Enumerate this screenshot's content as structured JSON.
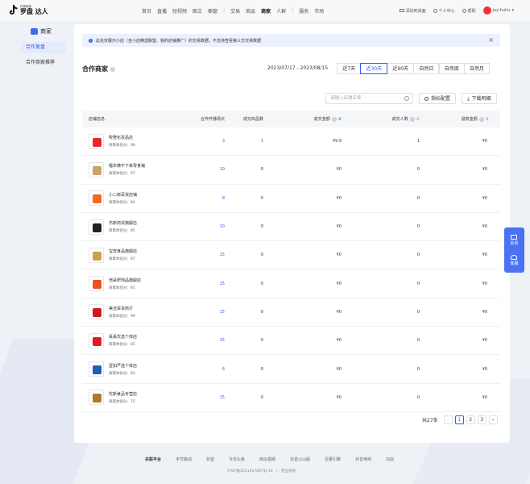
{
  "brand": {
    "small": "抖音电商",
    "big": "罗盘 达人"
  },
  "nav": {
    "items": [
      "首页",
      "直播",
      "短视频",
      "图文",
      "橱窗",
      "交易",
      "商品",
      "商家",
      "人群",
      "服务",
      "市场"
    ],
    "active": "商家"
  },
  "top_right": {
    "add_desktop": "添加到桌面",
    "personal_center": "个人中心",
    "help": "帮助",
    "username": "joy-huhu"
  },
  "sidebar": {
    "title": "商家",
    "items": [
      {
        "label": "合作复盘",
        "active": true
      },
      {
        "label": "合作商家推荐",
        "active": false
      }
    ]
  },
  "notice": {
    "text": "此处仅展示小店（含小店精选联盟、我的店铺推广）的交易数据，不支持查看第三方交易数据"
  },
  "section": {
    "title": "合作商家",
    "date_range": "2023/07/17 - 2023/08/15",
    "ranges": [
      {
        "label": "近7天",
        "active": false
      },
      {
        "label": "近30天",
        "active": true
      },
      {
        "label": "近90天",
        "active": false
      },
      {
        "label": "自然日",
        "active": false
      },
      {
        "label": "自然周",
        "active": false
      },
      {
        "label": "自然月",
        "active": false
      }
    ]
  },
  "toolbar": {
    "search_placeholder": "请输入店铺名称",
    "metrics_label": "指标配置",
    "download_label": "下载明细"
  },
  "table": {
    "headers": {
      "shop": "店铺信息",
      "sessions": "合作开播场次",
      "products": "成交商品数",
      "gmv": "成交金额",
      "buyers": "成交人数",
      "refund": "退款金额"
    },
    "score_prefix": "商家体验分：",
    "rows": [
      {
        "name": "牧橙化妆品店",
        "score": "98",
        "sessions": "3",
        "products": "1",
        "gmv": "¥9.9",
        "buyers": "1",
        "refund": "¥0",
        "logo_color": "#e8262d"
      },
      {
        "name": "榴本佛不下来零食铺",
        "score": "97",
        "sessions": "10",
        "products": "0",
        "gmv": "¥0",
        "buyers": "0",
        "refund": "¥0",
        "logo_color": "#c9a46a"
      },
      {
        "name": "小二郎百货店铺",
        "score": "84",
        "sessions": "8",
        "products": "0",
        "gmv": "¥0",
        "buyers": "0",
        "refund": "¥0",
        "logo_color": "#f06a1f"
      },
      {
        "name": "杰斯商贸旗舰店",
        "score": "85",
        "sessions": "10",
        "products": "0",
        "gmv": "¥0",
        "buyers": "0",
        "refund": "¥0",
        "logo_color": "#222222"
      },
      {
        "name": "宝宾食品旗舰店",
        "score": "97",
        "sessions": "15",
        "products": "0",
        "gmv": "¥0",
        "buyers": "0",
        "refund": "¥0",
        "logo_color": "#c9a24a"
      },
      {
        "name": "倍朵妍饰品旗舰店",
        "score": "91",
        "sessions": "15",
        "products": "0",
        "gmv": "¥0",
        "buyers": "0",
        "refund": "¥0",
        "logo_color": "#e8531f"
      },
      {
        "name": "美洁百货商行",
        "score": "99",
        "sessions": "15",
        "products": "0",
        "gmv": "¥0",
        "buyers": "0",
        "refund": "¥0",
        "logo_color": "#d0181e"
      },
      {
        "name": "丢丢优选个体店",
        "score": "85",
        "sessions": "15",
        "products": "0",
        "gmv": "¥0",
        "buyers": "0",
        "refund": "¥0",
        "logo_color": "#e01a23"
      },
      {
        "name": "壹如严选个体店",
        "score": "83",
        "sessions": "6",
        "products": "0",
        "gmv": "¥0",
        "buyers": "0",
        "refund": "¥0",
        "logo_color": "#1f5fb8"
      },
      {
        "name": "优斯食品专营店",
        "score": "75",
        "sessions": "15",
        "products": "0",
        "gmv": "¥0",
        "buyers": "0",
        "refund": "¥0",
        "logo_color": "#b07a2a"
      }
    ]
  },
  "pagination": {
    "total": "共27条",
    "prev": "‹",
    "pages": [
      "1",
      "2",
      "3"
    ],
    "active": "1",
    "next": "›"
  },
  "float": {
    "feedback": "反馈",
    "service": "客服"
  },
  "footer": {
    "links": [
      "关联平台",
      "字节跳动",
      "抖音",
      "今日头条",
      "西瓜视频",
      "抖音火山版",
      "巨量引擎",
      "抖音电商",
      "抖店"
    ],
    "icp": "沪ICP备2021017807号-10",
    "license": "营业执照"
  },
  "icons": {
    "help": "question-circle-icon",
    "info": "info-circle-icon",
    "close": "close-icon",
    "search": "search-icon",
    "settings": "gear-icon",
    "download": "download-icon",
    "sort": "sort-icon"
  },
  "colors": {
    "accent": "#2f5cf0",
    "notice_bg": "#ebf1fd",
    "float_bg": "#4a72f3"
  }
}
